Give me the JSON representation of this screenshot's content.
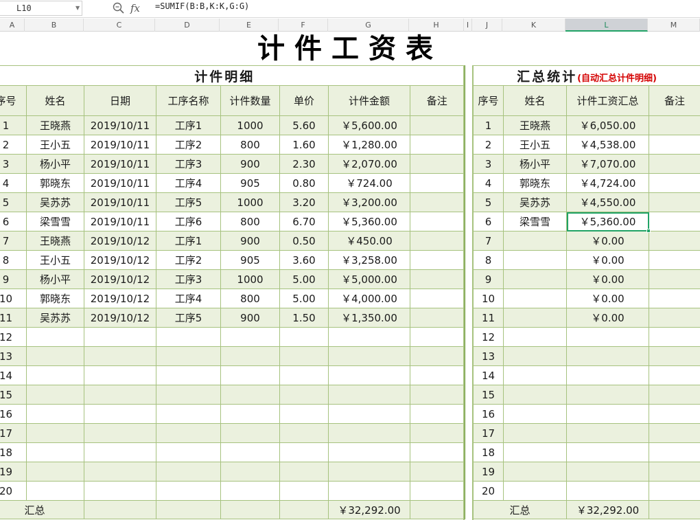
{
  "formula_bar": {
    "cell_ref": "L10",
    "fx_label": "fx",
    "formula": "=SUMIF(B:B,K:K,G:G)"
  },
  "columns": [
    "A",
    "B",
    "C",
    "D",
    "E",
    "F",
    "G",
    "H",
    "I",
    "J",
    "K",
    "L",
    "M"
  ],
  "selected_column": "L",
  "sheet_title": "计件工资表",
  "left": {
    "section_title": "计件明细",
    "headers": [
      "序号",
      "姓名",
      "日期",
      "工序名称",
      "计件数量",
      "单价",
      "计件金额",
      "备注"
    ],
    "rows": [
      [
        "1",
        "王晓燕",
        "2019/10/11",
        "工序1",
        "1000",
        "5.60",
        "￥5,600.00",
        ""
      ],
      [
        "2",
        "王小五",
        "2019/10/11",
        "工序2",
        "800",
        "1.60",
        "￥1,280.00",
        ""
      ],
      [
        "3",
        "杨小平",
        "2019/10/11",
        "工序3",
        "900",
        "2.30",
        "￥2,070.00",
        ""
      ],
      [
        "4",
        "郭晓东",
        "2019/10/11",
        "工序4",
        "905",
        "0.80",
        "￥724.00",
        ""
      ],
      [
        "5",
        "吴苏苏",
        "2019/10/11",
        "工序5",
        "1000",
        "3.20",
        "￥3,200.00",
        ""
      ],
      [
        "6",
        "梁雪雪",
        "2019/10/11",
        "工序6",
        "800",
        "6.70",
        "￥5,360.00",
        ""
      ],
      [
        "7",
        "王晓燕",
        "2019/10/12",
        "工序1",
        "900",
        "0.50",
        "￥450.00",
        ""
      ],
      [
        "8",
        "王小五",
        "2019/10/12",
        "工序2",
        "905",
        "3.60",
        "￥3,258.00",
        ""
      ],
      [
        "9",
        "杨小平",
        "2019/10/12",
        "工序3",
        "1000",
        "5.00",
        "￥5,000.00",
        ""
      ],
      [
        "10",
        "郭晓东",
        "2019/10/12",
        "工序4",
        "800",
        "5.00",
        "￥4,000.00",
        ""
      ],
      [
        "11",
        "吴苏苏",
        "2019/10/12",
        "工序5",
        "900",
        "1.50",
        "￥1,350.00",
        ""
      ],
      [
        "12",
        "",
        "",
        "",
        "",
        "",
        "",
        ""
      ],
      [
        "13",
        "",
        "",
        "",
        "",
        "",
        "",
        ""
      ],
      [
        "14",
        "",
        "",
        "",
        "",
        "",
        "",
        ""
      ],
      [
        "15",
        "",
        "",
        "",
        "",
        "",
        "",
        ""
      ],
      [
        "16",
        "",
        "",
        "",
        "",
        "",
        "",
        ""
      ],
      [
        "17",
        "",
        "",
        "",
        "",
        "",
        "",
        ""
      ],
      [
        "18",
        "",
        "",
        "",
        "",
        "",
        "",
        ""
      ],
      [
        "19",
        "",
        "",
        "",
        "",
        "",
        "",
        ""
      ],
      [
        "20",
        "",
        "",
        "",
        "",
        "",
        "",
        ""
      ]
    ],
    "total_label": "汇总",
    "total_value": "￥32,292.00"
  },
  "right": {
    "section_title": "汇总统计",
    "section_note": "(自动汇总计件明细)",
    "headers": [
      "序号",
      "姓名",
      "计件工资汇总",
      "备注"
    ],
    "rows": [
      [
        "1",
        "王晓燕",
        "￥6,050.00",
        ""
      ],
      [
        "2",
        "王小五",
        "￥4,538.00",
        ""
      ],
      [
        "3",
        "杨小平",
        "￥7,070.00",
        ""
      ],
      [
        "4",
        "郭晓东",
        "￥4,724.00",
        ""
      ],
      [
        "5",
        "吴苏苏",
        "￥4,550.00",
        ""
      ],
      [
        "6",
        "梁雪雪",
        "￥5,360.00",
        ""
      ],
      [
        "7",
        "",
        "￥0.00",
        ""
      ],
      [
        "8",
        "",
        "￥0.00",
        ""
      ],
      [
        "9",
        "",
        "￥0.00",
        ""
      ],
      [
        "10",
        "",
        "￥0.00",
        ""
      ],
      [
        "11",
        "",
        "￥0.00",
        ""
      ],
      [
        "12",
        "",
        "",
        ""
      ],
      [
        "13",
        "",
        "",
        ""
      ],
      [
        "14",
        "",
        "",
        ""
      ],
      [
        "15",
        "",
        "",
        ""
      ],
      [
        "16",
        "",
        "",
        ""
      ],
      [
        "17",
        "",
        "",
        ""
      ],
      [
        "18",
        "",
        "",
        ""
      ],
      [
        "19",
        "",
        "",
        ""
      ],
      [
        "20",
        "",
        "",
        ""
      ]
    ],
    "total_label": "汇总",
    "total_value": "￥32,292.00",
    "active_row_index": 5
  },
  "colors": {
    "band_green": "#ebf1de",
    "border_green": "#a6c27e",
    "selection_green": "#21a366",
    "note_red": "#d40000"
  }
}
